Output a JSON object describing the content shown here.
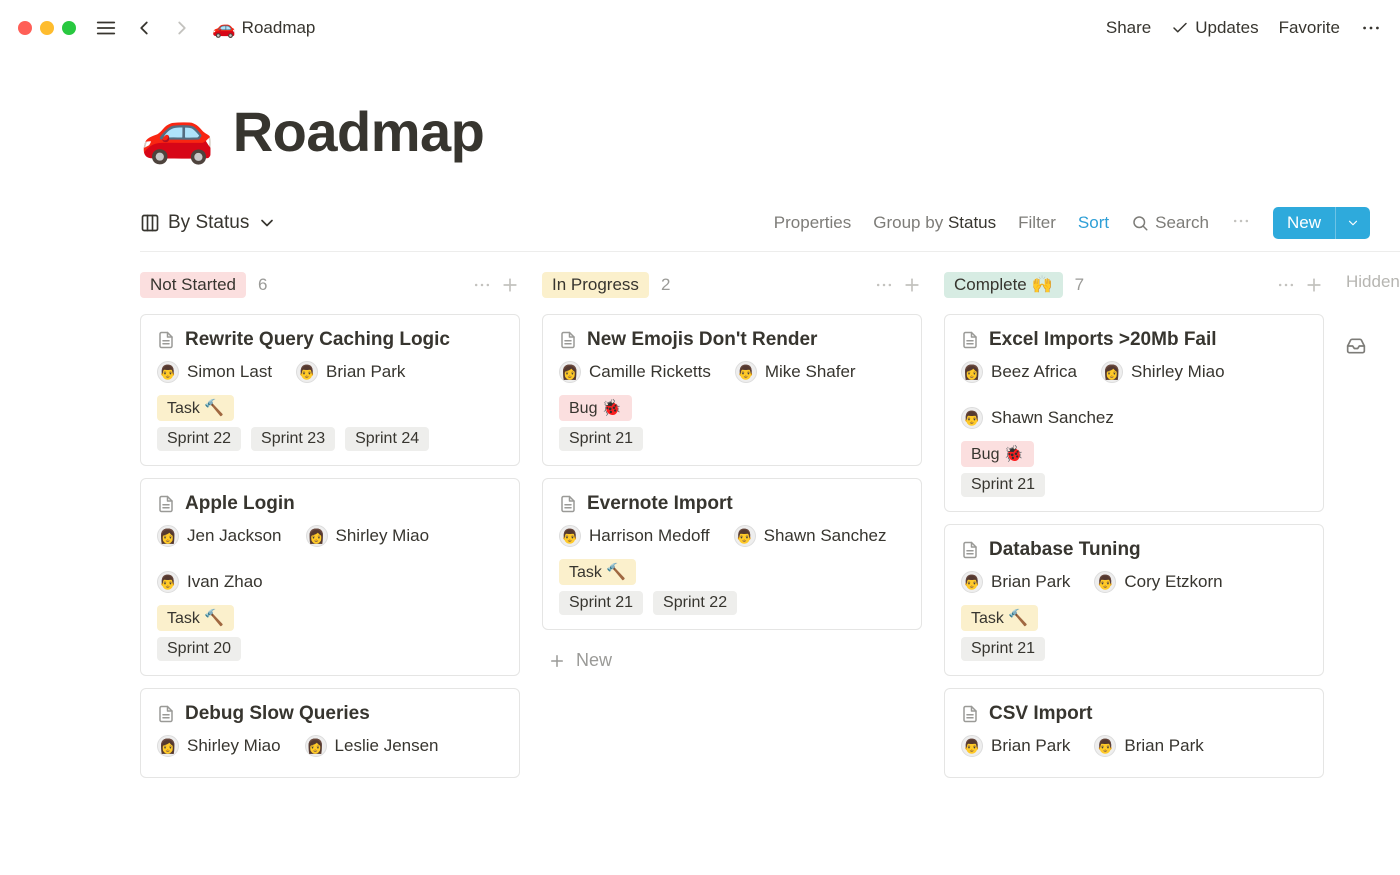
{
  "topbar": {
    "breadcrumb_emoji": "🚗",
    "breadcrumb": "Roadmap",
    "share": "Share",
    "updates": "Updates",
    "favorite": "Favorite"
  },
  "page": {
    "emoji": "🚗",
    "title": "Roadmap"
  },
  "controls": {
    "view_label": "By Status",
    "properties": "Properties",
    "group_by_label": "Group by",
    "group_by_value": "Status",
    "filter": "Filter",
    "sort": "Sort",
    "search": "Search",
    "new": "New"
  },
  "hidden_label": "Hidden",
  "new_card_label": "New",
  "columns": [
    {
      "status": "Not Started",
      "status_class": "tag-notstarted",
      "count": "6",
      "cards": [
        {
          "title": "Rewrite Query Caching Logic",
          "assignees": [
            {
              "emoji": "👨",
              "name": "Simon Last"
            },
            {
              "emoji": "👨",
              "name": "Brian Park"
            }
          ],
          "type": {
            "label": "Task 🔨",
            "class": "chip-task"
          },
          "sprints": [
            "Sprint 22",
            "Sprint 23",
            "Sprint 24"
          ]
        },
        {
          "title": "Apple Login",
          "assignees": [
            {
              "emoji": "👩",
              "name": "Jen Jackson"
            },
            {
              "emoji": "👩",
              "name": "Shirley Miao"
            },
            {
              "emoji": "👨",
              "name": "Ivan Zhao"
            }
          ],
          "type": {
            "label": "Task 🔨",
            "class": "chip-task"
          },
          "sprints": [
            "Sprint 20"
          ]
        },
        {
          "title": "Debug Slow Queries",
          "assignees": [
            {
              "emoji": "👩",
              "name": "Shirley Miao"
            },
            {
              "emoji": "👩",
              "name": "Leslie Jensen"
            }
          ],
          "type": null,
          "sprints": []
        }
      ]
    },
    {
      "status": "In Progress",
      "status_class": "tag-inprogress",
      "count": "2",
      "cards": [
        {
          "title": "New Emojis Don't Render",
          "assignees": [
            {
              "emoji": "👩",
              "name": "Camille Ricketts"
            },
            {
              "emoji": "👨",
              "name": "Mike Shafer"
            }
          ],
          "type": {
            "label": "Bug 🐞",
            "class": "chip-bug"
          },
          "sprints": [
            "Sprint 21"
          ]
        },
        {
          "title": "Evernote Import",
          "assignees": [
            {
              "emoji": "👨",
              "name": "Harrison Medoff"
            },
            {
              "emoji": "👨",
              "name": "Shawn Sanchez"
            }
          ],
          "type": {
            "label": "Task 🔨",
            "class": "chip-task"
          },
          "sprints": [
            "Sprint 21",
            "Sprint 22"
          ]
        }
      ],
      "show_new": true
    },
    {
      "status": "Complete 🙌",
      "status_class": "tag-complete",
      "count": "7",
      "cards": [
        {
          "title": "Excel Imports >20Mb Fail",
          "assignees": [
            {
              "emoji": "👩",
              "name": "Beez Africa"
            },
            {
              "emoji": "👩",
              "name": "Shirley Miao"
            },
            {
              "emoji": "👨",
              "name": "Shawn Sanchez"
            }
          ],
          "type": {
            "label": "Bug 🐞",
            "class": "chip-bug"
          },
          "sprints": [
            "Sprint 21"
          ]
        },
        {
          "title": "Database Tuning",
          "assignees": [
            {
              "emoji": "👨",
              "name": "Brian Park"
            },
            {
              "emoji": "👨",
              "name": "Cory Etzkorn"
            }
          ],
          "type": {
            "label": "Task 🔨",
            "class": "chip-task"
          },
          "sprints": [
            "Sprint 21"
          ]
        },
        {
          "title": "CSV Import",
          "assignees": [
            {
              "emoji": "👨",
              "name": "Brian Park"
            },
            {
              "emoji": "👨",
              "name": "Brian Park"
            }
          ],
          "type": null,
          "sprints": []
        }
      ]
    }
  ]
}
